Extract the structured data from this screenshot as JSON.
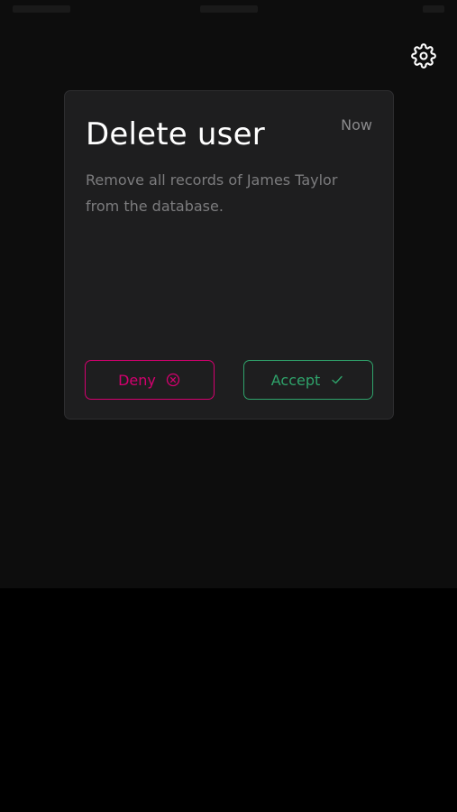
{
  "colors": {
    "background": "#0d0d0d",
    "card": "#1e1e1f",
    "title": "#ffffff",
    "muted": "#7c7c7e",
    "deny": "#d4006f",
    "accept": "#2fa36b"
  },
  "header": {
    "settings_icon": "gear-icon"
  },
  "notification": {
    "title": "Delete user",
    "time": "Now",
    "message": "Remove all records of James Taylor from the database.",
    "deny_label": "Deny",
    "deny_icon": "circle-x-icon",
    "accept_label": "Accept",
    "accept_icon": "check-icon"
  }
}
